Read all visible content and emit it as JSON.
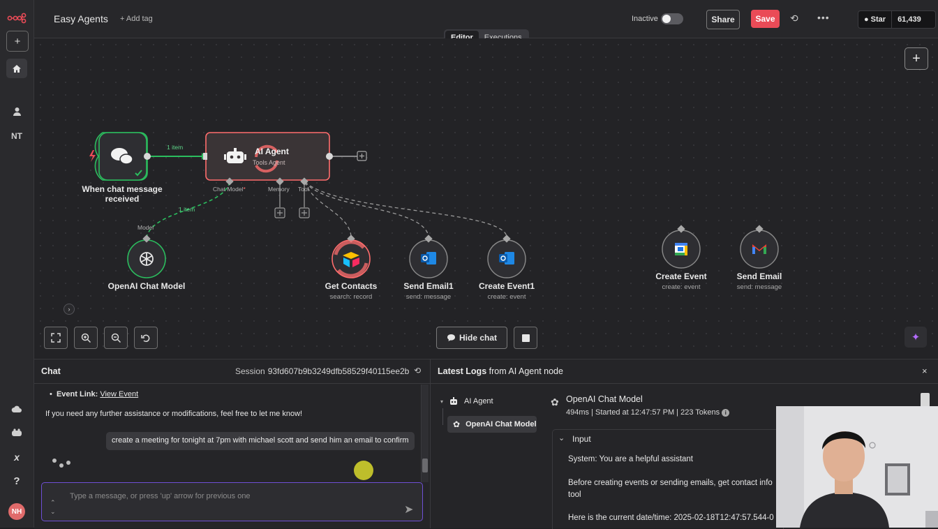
{
  "app": {
    "workflow_name": "Easy Agents",
    "add_tag": "+ Add tag",
    "status_label": "Inactive",
    "share": "Share",
    "save": "Save",
    "github_star": "Star",
    "github_count": "61,439"
  },
  "sidebar": {
    "initials": "NT",
    "avatar": "NH"
  },
  "tabs": [
    {
      "label": "Editor",
      "active": true
    },
    {
      "label": "Executions",
      "active": false
    }
  ],
  "nodes": {
    "trigger": {
      "title_l1": "When chat message",
      "title_l2": "received"
    },
    "agent": {
      "title": "AI Agent",
      "subtitle": "Tools Agent"
    },
    "model": {
      "title": "OpenAI Chat Model"
    },
    "get_contacts": {
      "title": "Get Contacts",
      "subtitle": "search: record"
    },
    "send_email1": {
      "title": "Send Email1",
      "subtitle": "send: message"
    },
    "create_event1": {
      "title": "Create Event1",
      "subtitle": "create: event"
    },
    "create_event": {
      "title": "Create Event",
      "subtitle": "create: event"
    },
    "send_email": {
      "title": "Send Email",
      "subtitle": "send: message"
    }
  },
  "ports": {
    "chat_model": "Chat Model",
    "required_marker": "*",
    "memory": "Memory",
    "tool": "Tool",
    "model": "Model",
    "items_main": "1 item",
    "items_model": "1 item"
  },
  "canvas_controls": {
    "hide_chat": "Hide chat"
  },
  "chat": {
    "title": "Chat",
    "session_label": "Session",
    "session_id": "93fd607b9b3249dfb58529f40115ee2b",
    "bullet_label": "Event Link:",
    "bullet_link": "View Event",
    "bot_message": "If you need any further assistance or modifications, feel free to let me know!",
    "user_message": "create a meeting for tonight at 7pm with michael scott and send him an email to confirm",
    "input_placeholder": "Type a message, or press 'up' arrow for previous one"
  },
  "logs": {
    "title_bold": "Latest Logs",
    "title_rest": "from AI Agent node",
    "tree_agent": "AI Agent",
    "tree_model": "OpenAI Chat Model",
    "run_title": "OpenAI Chat Model",
    "run_meta": "494ms | Started at 12:47:57 PM | 223 Tokens",
    "input_label": "Input",
    "line1": "System: You are a helpful assistant",
    "line2": "Before creating events or sending emails, get contact info",
    "line3": "tool",
    "line4": "Here is the current date/time: 2025-02-18T12:47:57.544-0"
  },
  "colors": {
    "accent": "#ea4b57",
    "success": "#22c55e",
    "agent_border": "#ff6d6d",
    "input_focus": "#6f4fd6"
  }
}
